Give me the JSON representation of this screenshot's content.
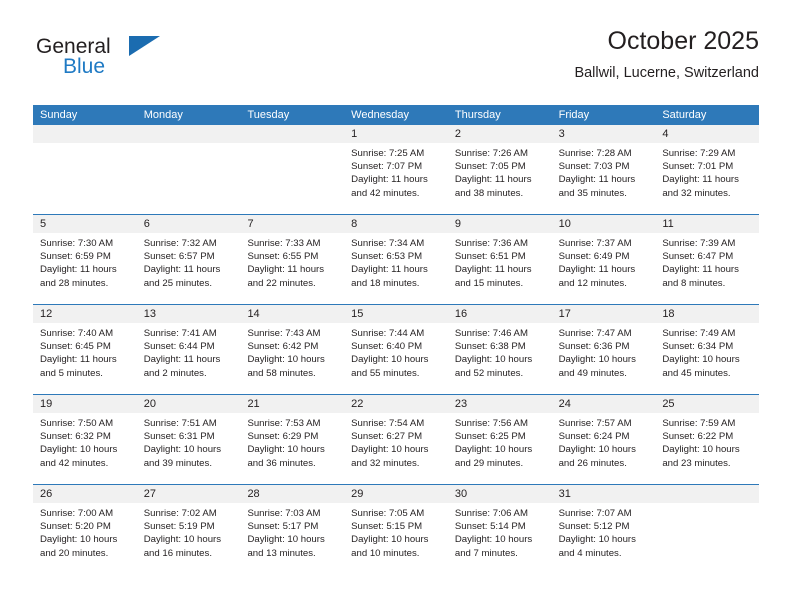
{
  "brand": {
    "name_primary": "General",
    "name_secondary": "Blue",
    "logo_icon": "triangle-flag-icon"
  },
  "header": {
    "title": "October 2025",
    "subtitle": "Ballwil, Lucerne, Switzerland"
  },
  "colors": {
    "header_blue": "#2e79b9",
    "brand_blue": "#1f7ac4",
    "day_band_gray": "#f1f1f1",
    "text": "#231f20"
  },
  "weekdays": [
    "Sunday",
    "Monday",
    "Tuesday",
    "Wednesday",
    "Thursday",
    "Friday",
    "Saturday"
  ],
  "weeks": [
    [
      {
        "day": "",
        "empty": true
      },
      {
        "day": "",
        "empty": true
      },
      {
        "day": "",
        "empty": true
      },
      {
        "day": "1",
        "sunrise": "Sunrise: 7:25 AM",
        "sunset": "Sunset: 7:07 PM",
        "daylight_line1": "Daylight: 11 hours",
        "daylight_line2": "and 42 minutes."
      },
      {
        "day": "2",
        "sunrise": "Sunrise: 7:26 AM",
        "sunset": "Sunset: 7:05 PM",
        "daylight_line1": "Daylight: 11 hours",
        "daylight_line2": "and 38 minutes."
      },
      {
        "day": "3",
        "sunrise": "Sunrise: 7:28 AM",
        "sunset": "Sunset: 7:03 PM",
        "daylight_line1": "Daylight: 11 hours",
        "daylight_line2": "and 35 minutes."
      },
      {
        "day": "4",
        "sunrise": "Sunrise: 7:29 AM",
        "sunset": "Sunset: 7:01 PM",
        "daylight_line1": "Daylight: 11 hours",
        "daylight_line2": "and 32 minutes."
      }
    ],
    [
      {
        "day": "5",
        "sunrise": "Sunrise: 7:30 AM",
        "sunset": "Sunset: 6:59 PM",
        "daylight_line1": "Daylight: 11 hours",
        "daylight_line2": "and 28 minutes."
      },
      {
        "day": "6",
        "sunrise": "Sunrise: 7:32 AM",
        "sunset": "Sunset: 6:57 PM",
        "daylight_line1": "Daylight: 11 hours",
        "daylight_line2": "and 25 minutes."
      },
      {
        "day": "7",
        "sunrise": "Sunrise: 7:33 AM",
        "sunset": "Sunset: 6:55 PM",
        "daylight_line1": "Daylight: 11 hours",
        "daylight_line2": "and 22 minutes."
      },
      {
        "day": "8",
        "sunrise": "Sunrise: 7:34 AM",
        "sunset": "Sunset: 6:53 PM",
        "daylight_line1": "Daylight: 11 hours",
        "daylight_line2": "and 18 minutes."
      },
      {
        "day": "9",
        "sunrise": "Sunrise: 7:36 AM",
        "sunset": "Sunset: 6:51 PM",
        "daylight_line1": "Daylight: 11 hours",
        "daylight_line2": "and 15 minutes."
      },
      {
        "day": "10",
        "sunrise": "Sunrise: 7:37 AM",
        "sunset": "Sunset: 6:49 PM",
        "daylight_line1": "Daylight: 11 hours",
        "daylight_line2": "and 12 minutes."
      },
      {
        "day": "11",
        "sunrise": "Sunrise: 7:39 AM",
        "sunset": "Sunset: 6:47 PM",
        "daylight_line1": "Daylight: 11 hours",
        "daylight_line2": "and 8 minutes."
      }
    ],
    [
      {
        "day": "12",
        "sunrise": "Sunrise: 7:40 AM",
        "sunset": "Sunset: 6:45 PM",
        "daylight_line1": "Daylight: 11 hours",
        "daylight_line2": "and 5 minutes."
      },
      {
        "day": "13",
        "sunrise": "Sunrise: 7:41 AM",
        "sunset": "Sunset: 6:44 PM",
        "daylight_line1": "Daylight: 11 hours",
        "daylight_line2": "and 2 minutes."
      },
      {
        "day": "14",
        "sunrise": "Sunrise: 7:43 AM",
        "sunset": "Sunset: 6:42 PM",
        "daylight_line1": "Daylight: 10 hours",
        "daylight_line2": "and 58 minutes."
      },
      {
        "day": "15",
        "sunrise": "Sunrise: 7:44 AM",
        "sunset": "Sunset: 6:40 PM",
        "daylight_line1": "Daylight: 10 hours",
        "daylight_line2": "and 55 minutes."
      },
      {
        "day": "16",
        "sunrise": "Sunrise: 7:46 AM",
        "sunset": "Sunset: 6:38 PM",
        "daylight_line1": "Daylight: 10 hours",
        "daylight_line2": "and 52 minutes."
      },
      {
        "day": "17",
        "sunrise": "Sunrise: 7:47 AM",
        "sunset": "Sunset: 6:36 PM",
        "daylight_line1": "Daylight: 10 hours",
        "daylight_line2": "and 49 minutes."
      },
      {
        "day": "18",
        "sunrise": "Sunrise: 7:49 AM",
        "sunset": "Sunset: 6:34 PM",
        "daylight_line1": "Daylight: 10 hours",
        "daylight_line2": "and 45 minutes."
      }
    ],
    [
      {
        "day": "19",
        "sunrise": "Sunrise: 7:50 AM",
        "sunset": "Sunset: 6:32 PM",
        "daylight_line1": "Daylight: 10 hours",
        "daylight_line2": "and 42 minutes."
      },
      {
        "day": "20",
        "sunrise": "Sunrise: 7:51 AM",
        "sunset": "Sunset: 6:31 PM",
        "daylight_line1": "Daylight: 10 hours",
        "daylight_line2": "and 39 minutes."
      },
      {
        "day": "21",
        "sunrise": "Sunrise: 7:53 AM",
        "sunset": "Sunset: 6:29 PM",
        "daylight_line1": "Daylight: 10 hours",
        "daylight_line2": "and 36 minutes."
      },
      {
        "day": "22",
        "sunrise": "Sunrise: 7:54 AM",
        "sunset": "Sunset: 6:27 PM",
        "daylight_line1": "Daylight: 10 hours",
        "daylight_line2": "and 32 minutes."
      },
      {
        "day": "23",
        "sunrise": "Sunrise: 7:56 AM",
        "sunset": "Sunset: 6:25 PM",
        "daylight_line1": "Daylight: 10 hours",
        "daylight_line2": "and 29 minutes."
      },
      {
        "day": "24",
        "sunrise": "Sunrise: 7:57 AM",
        "sunset": "Sunset: 6:24 PM",
        "daylight_line1": "Daylight: 10 hours",
        "daylight_line2": "and 26 minutes."
      },
      {
        "day": "25",
        "sunrise": "Sunrise: 7:59 AM",
        "sunset": "Sunset: 6:22 PM",
        "daylight_line1": "Daylight: 10 hours",
        "daylight_line2": "and 23 minutes."
      }
    ],
    [
      {
        "day": "26",
        "sunrise": "Sunrise: 7:00 AM",
        "sunset": "Sunset: 5:20 PM",
        "daylight_line1": "Daylight: 10 hours",
        "daylight_line2": "and 20 minutes."
      },
      {
        "day": "27",
        "sunrise": "Sunrise: 7:02 AM",
        "sunset": "Sunset: 5:19 PM",
        "daylight_line1": "Daylight: 10 hours",
        "daylight_line2": "and 16 minutes."
      },
      {
        "day": "28",
        "sunrise": "Sunrise: 7:03 AM",
        "sunset": "Sunset: 5:17 PM",
        "daylight_line1": "Daylight: 10 hours",
        "daylight_line2": "and 13 minutes."
      },
      {
        "day": "29",
        "sunrise": "Sunrise: 7:05 AM",
        "sunset": "Sunset: 5:15 PM",
        "daylight_line1": "Daylight: 10 hours",
        "daylight_line2": "and 10 minutes."
      },
      {
        "day": "30",
        "sunrise": "Sunrise: 7:06 AM",
        "sunset": "Sunset: 5:14 PM",
        "daylight_line1": "Daylight: 10 hours",
        "daylight_line2": "and 7 minutes."
      },
      {
        "day": "31",
        "sunrise": "Sunrise: 7:07 AM",
        "sunset": "Sunset: 5:12 PM",
        "daylight_line1": "Daylight: 10 hours",
        "daylight_line2": "and 4 minutes."
      },
      {
        "day": "",
        "empty": true
      }
    ]
  ]
}
